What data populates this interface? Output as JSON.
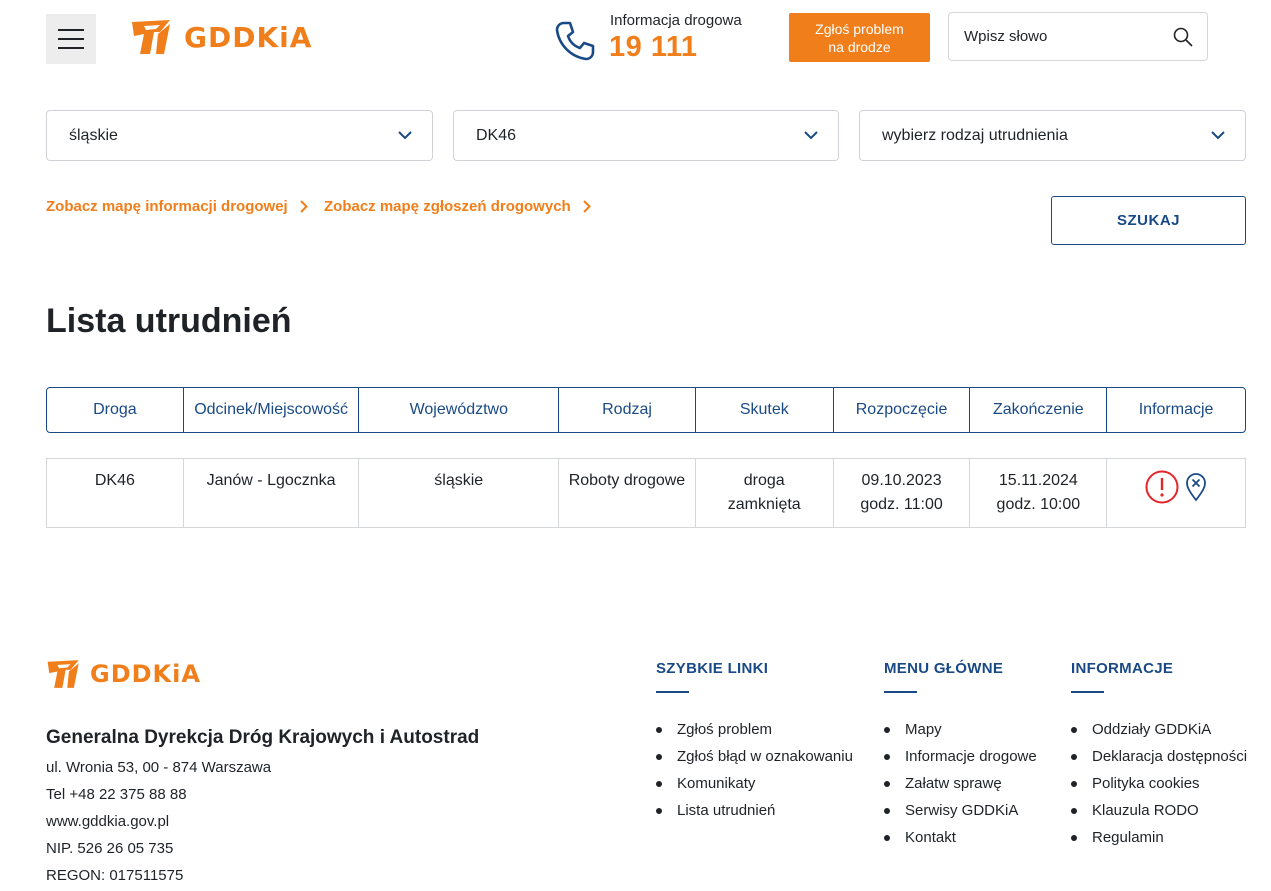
{
  "brand": {
    "name": "GDDKiA",
    "color": "#f07e1b"
  },
  "header": {
    "menu_icon": "hamburger-icon",
    "phone_label": "Informacja drogowa",
    "phone_number": "19 111",
    "report_button": "Zgłoś problem na drodze",
    "search_placeholder": "Wpisz słowo"
  },
  "filters": {
    "voivodeship": "śląskie",
    "road": "DK46",
    "type": "wybierz rodzaj utrudnienia",
    "link_info_map": "Zobacz mapę informacji drogowej",
    "link_reports_map": "Zobacz mapę zgłoszeń drogowych",
    "search_button": "SZUKAJ"
  },
  "list": {
    "title": "Lista utrudnień",
    "columns": [
      "Droga",
      "Odcinek/Miejscowość",
      "Województwo",
      "Rodzaj",
      "Skutek",
      "Rozpoczęcie",
      "Zakończenie",
      "Informacje"
    ],
    "rows": [
      {
        "road": "DK46",
        "section": "Janów - Lgocznka",
        "voivodeship": "śląskie",
        "kind": "Roboty drogowe",
        "effect": "droga zamknięta",
        "start": "09.10.2023 godz. 11:00",
        "end": "15.11.2024 godz. 10:00",
        "icons": [
          "warning-icon",
          "map-pin-closed-icon"
        ]
      }
    ]
  },
  "footer": {
    "org_name": "Generalna Dyrekcja Dróg Krajowych i Autostrad",
    "address": "ul. Wronia 53, 00 - 874 Warszawa",
    "phone": "Tel +48 22 375 88 88",
    "website": "www.gddkia.gov.pl",
    "nip": "NIP. 526 26 05 735",
    "regon": "REGON: 017511575",
    "columns": [
      {
        "title": "SZYBKIE LINKI",
        "items": [
          "Zgłoś problem",
          "Zgłoś błąd w oznakowaniu",
          "Komunikaty",
          "Lista utrudnień"
        ]
      },
      {
        "title": "MENU GŁÓWNE",
        "items": [
          "Mapy",
          "Informacje drogowe",
          "Załatw sprawę",
          "Serwisy GDDKiA",
          "Kontakt"
        ]
      },
      {
        "title": "INFORMACJE",
        "items": [
          "Oddziały GDDKiA",
          "Deklaracja dostępności",
          "Polityka cookies",
          "Klauzula RODO",
          "Regulamin"
        ]
      }
    ]
  },
  "colors": {
    "accent": "#f07e1b",
    "primary": "#1a4a86",
    "warning": "#e3262c"
  }
}
